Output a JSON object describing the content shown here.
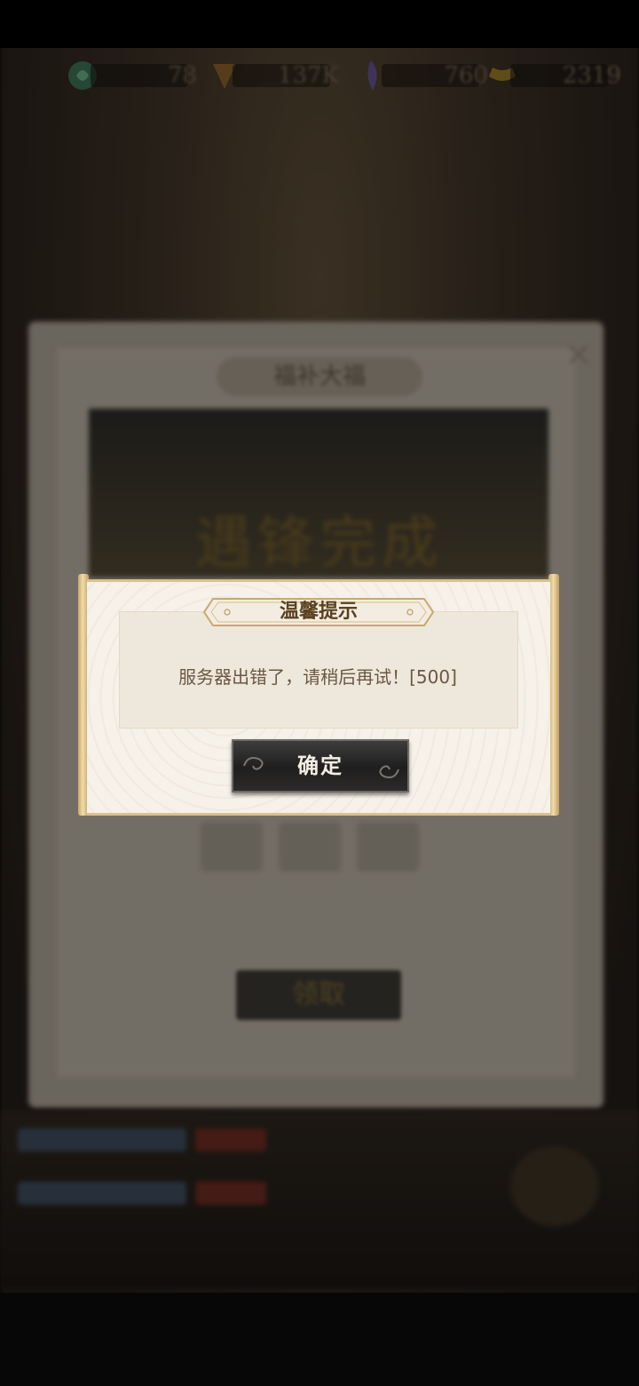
{
  "resources": [
    {
      "icon": "jade-orb-icon",
      "value": "78",
      "color": "#4fb07a"
    },
    {
      "icon": "gold-emblem-icon",
      "value": "137K",
      "color": "#b07a2e"
    },
    {
      "icon": "purple-feather-icon",
      "value": "760",
      "color": "#7d68c9"
    },
    {
      "icon": "ingot-icon",
      "value": "2319",
      "color": "#c9a22c"
    }
  ],
  "background_panel": {
    "title": "福补大福",
    "banner_text": "遇锋完成",
    "claim_label": "领取"
  },
  "dialog": {
    "title": "温馨提示",
    "message": "服务器出错了，请稍后再试！[500]",
    "confirm_label": "确定"
  },
  "colors": {
    "dialog_bg": "#f6f1e9",
    "title_text": "#5a4220",
    "message_text": "#6b5840",
    "button_bg": "#1f1e1e",
    "button_text": "#f3eee4",
    "frame_gold": "#d9c08e"
  }
}
